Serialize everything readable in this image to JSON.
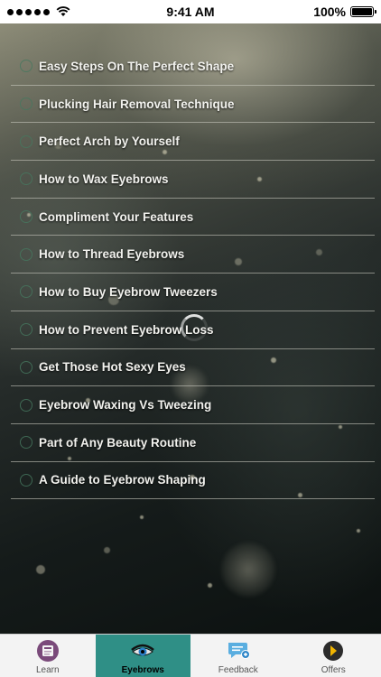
{
  "status_bar": {
    "time": "9:41 AM",
    "battery_percent": "100%",
    "signal_dots": 5
  },
  "menu": {
    "items": [
      {
        "label": "Easy Steps On The Perfect Shape"
      },
      {
        "label": "Plucking Hair Removal Technique"
      },
      {
        "label": "Perfect Arch by Yourself"
      },
      {
        "label": "How to Wax Eyebrows"
      },
      {
        "label": "Compliment Your Features"
      },
      {
        "label": "How to Thread Eyebrows"
      },
      {
        "label": "How to Buy Eyebrow Tweezers"
      },
      {
        "label": "How to Prevent Eyebrow Loss"
      },
      {
        "label": "Get Those Hot Sexy Eyes"
      },
      {
        "label": "Eyebrow Waxing Vs Tweezing"
      },
      {
        "label": "Part of Any Beauty Routine"
      },
      {
        "label": "A Guide to Eyebrow Shaping"
      }
    ]
  },
  "tabbar": {
    "active_color": "#2f8f86",
    "tabs": [
      {
        "label": "Learn",
        "icon": "book-icon"
      },
      {
        "label": "Eyebrows",
        "icon": "eye-icon"
      },
      {
        "label": "Feedback",
        "icon": "chat-bubble-icon"
      },
      {
        "label": "Offers",
        "icon": "play-circle-icon"
      }
    ]
  }
}
